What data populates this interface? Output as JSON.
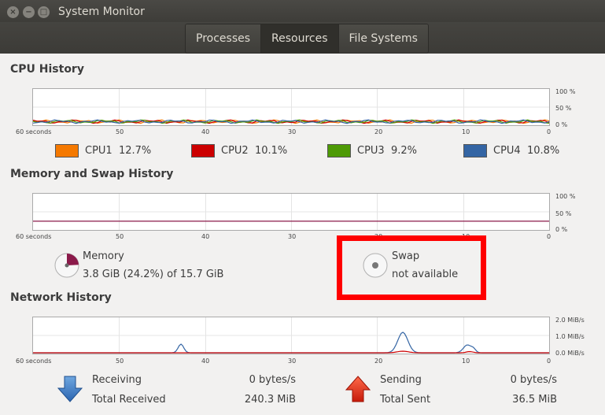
{
  "window": {
    "title": "System Monitor",
    "close_glyph": "×",
    "minimize_glyph": "−",
    "maximize_glyph": "□"
  },
  "tabs": [
    {
      "label": "Processes",
      "active": false
    },
    {
      "label": "Resources",
      "active": true
    },
    {
      "label": "File Systems",
      "active": false
    }
  ],
  "cpu": {
    "title": "CPU History",
    "y_ticks": [
      "100 %",
      "50 %",
      "0 %"
    ],
    "x_ticks": [
      "60 seconds",
      "50",
      "40",
      "30",
      "20",
      "10",
      "0"
    ],
    "legend": [
      {
        "label": "CPU1",
        "value": "12.7%",
        "color": "#f57900"
      },
      {
        "label": "CPU2",
        "value": "10.1%",
        "color": "#cc0000"
      },
      {
        "label": "CPU3",
        "value": "9.2%",
        "color": "#4e9a06"
      },
      {
        "label": "CPU4",
        "value": "10.8%",
        "color": "#3465a4"
      }
    ]
  },
  "memory": {
    "title": "Memory and Swap History",
    "y_ticks": [
      "100 %",
      "50 %",
      "0 %"
    ],
    "x_ticks": [
      "60 seconds",
      "50",
      "40",
      "30",
      "20",
      "10",
      "0"
    ],
    "memory_label": "Memory",
    "memory_detail": "3.8 GiB (24.2%) of 15.7 GiB",
    "memory_color": "#8b1a4a",
    "memory_percent": 24.2,
    "swap_label": "Swap",
    "swap_detail": "not available"
  },
  "network": {
    "title": "Network History",
    "y_ticks": [
      "2.0 MiB/s",
      "1.0 MiB/s",
      "0.0 MiB/s"
    ],
    "x_ticks": [
      "60 seconds",
      "50",
      "40",
      "30",
      "20",
      "10",
      "0"
    ],
    "receiving_label": "Receiving",
    "receiving_value": "0 bytes/s",
    "total_received_label": "Total Received",
    "total_received_value": "240.3 MiB",
    "sending_label": "Sending",
    "sending_value": "0 bytes/s",
    "total_sent_label": "Total Sent",
    "total_sent_value": "36.5 MiB",
    "receive_color": "#3465a4",
    "send_color": "#cc0000"
  }
}
